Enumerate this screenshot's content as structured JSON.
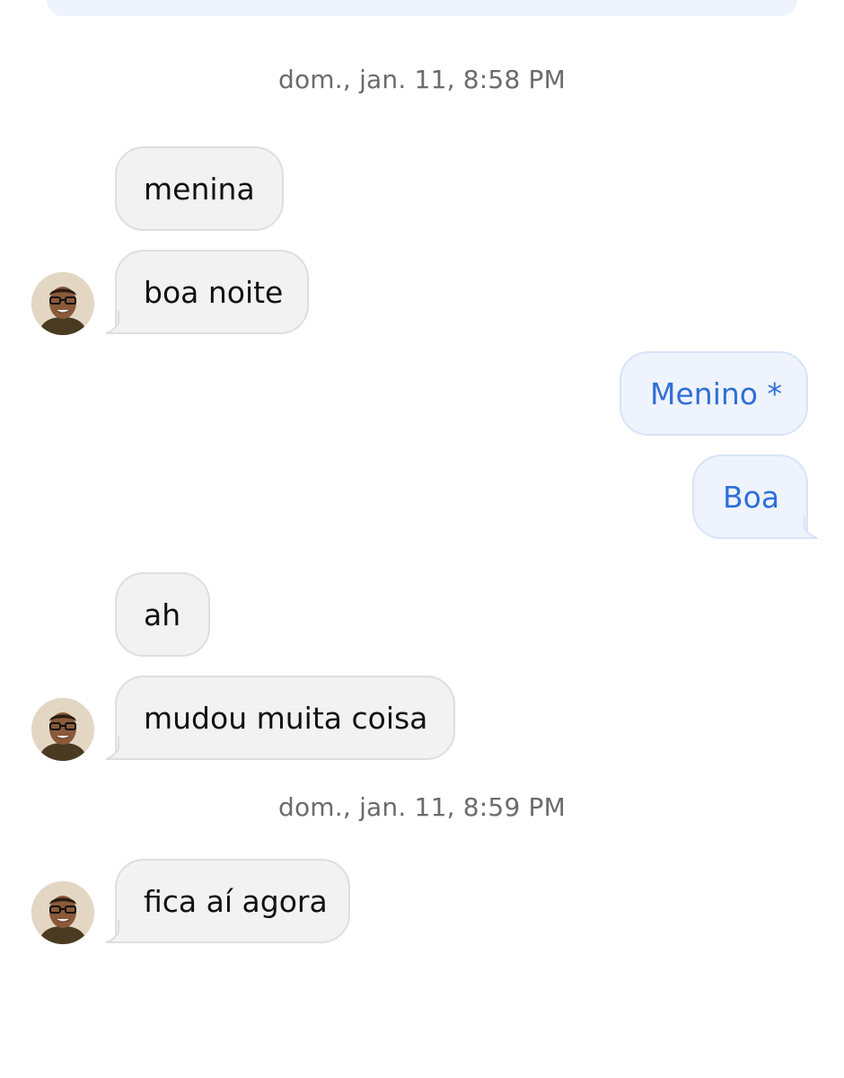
{
  "conversation": {
    "timestamps": [
      "dom., jan. 11, 8:58 PM",
      "dom., jan. 11, 8:59 PM"
    ],
    "messages": [
      {
        "sender": "contact",
        "text": "menina"
      },
      {
        "sender": "contact",
        "text": "boa noite"
      },
      {
        "sender": "me",
        "text": "Menino *"
      },
      {
        "sender": "me",
        "text": "Boa"
      },
      {
        "sender": "contact",
        "text": "ah"
      },
      {
        "sender": "contact",
        "text": "mudou muita coisa"
      },
      {
        "sender": "contact",
        "text": "fica aí agora"
      }
    ]
  },
  "icons": {
    "avatar": "contact-avatar-photo"
  },
  "colors": {
    "incoming_bubble": "#f2f2f2",
    "outgoing_bubble": "#eef3fd",
    "outgoing_text": "#2f6fd6",
    "timestamp_text": "#6b6b6b"
  }
}
